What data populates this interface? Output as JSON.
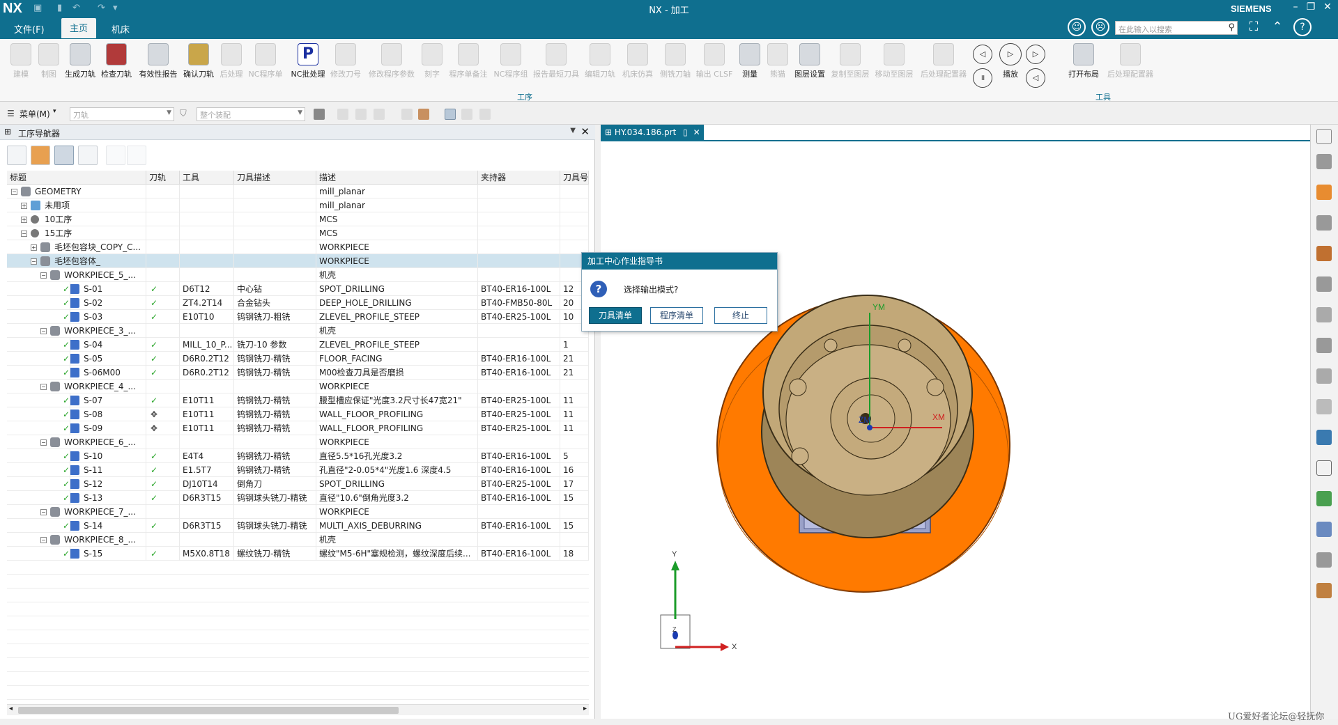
{
  "titlebar": {
    "logo": "NX",
    "title": "NX - 加工",
    "brand": "SIEMENS"
  },
  "menubar": {
    "file": "文件(F)",
    "home": "主页",
    "machine": "机床"
  },
  "search": {
    "placeholder": "在此输入以搜索"
  },
  "ribbon": {
    "buttons": [
      "建模",
      "制图",
      "生成刀轨",
      "检查刀轨",
      "有效性报告",
      "确认刀轨",
      "后处理",
      "NC程序单",
      "NC批处理",
      "修改刀号",
      "修改程序参数",
      "刻字",
      "程序单备注",
      "NC程序组",
      "报告最短刀具",
      "编辑刀轨",
      "机床仿真",
      "侧铣刀轴",
      "输出 CLSF",
      "测量",
      "熊猫",
      "图层设置",
      "复制至图层",
      "移动至图层",
      "后处理配置器"
    ],
    "right_buttons": [
      "播放",
      "打开布局",
      "后处理配置器"
    ],
    "groups": {
      "ops": "工序",
      "tools": "工具"
    }
  },
  "toolbar2": {
    "menu_label": "菜单(M)",
    "filter_path": "刀轨",
    "filter_asm": "整个装配"
  },
  "navigator": {
    "title": "工序导航器",
    "columns": [
      "标题",
      "刀轨",
      "工具",
      "刀具描述",
      "描述",
      "夹持器",
      "刀具号"
    ],
    "rows": [
      {
        "name": "GEOMETRY",
        "path": "",
        "tool": "",
        "tdesc": "",
        "desc": "mill_planar",
        "holder": "",
        "num": ""
      },
      {
        "name": "未用项",
        "path": "",
        "tool": "",
        "tdesc": "",
        "desc": "mill_planar",
        "holder": "",
        "num": ""
      },
      {
        "name": "10工序",
        "path": "",
        "tool": "",
        "tdesc": "",
        "desc": "MCS",
        "holder": "",
        "num": ""
      },
      {
        "name": "15工序",
        "path": "",
        "tool": "",
        "tdesc": "",
        "desc": "MCS",
        "holder": "",
        "num": ""
      },
      {
        "name": "毛坯包容块_COPY_C...",
        "path": "",
        "tool": "",
        "tdesc": "",
        "desc": "WORKPIECE",
        "holder": "",
        "num": ""
      },
      {
        "name": "毛坯包容体_",
        "path": "",
        "tool": "",
        "tdesc": "",
        "desc": "WORKPIECE",
        "holder": "",
        "num": ""
      },
      {
        "name": "WORKPIECE_5_...",
        "path": "",
        "tool": "",
        "tdesc": "",
        "desc": "机壳",
        "holder": "",
        "num": ""
      },
      {
        "name": "S-01",
        "path": "✓",
        "tool": "D6T12",
        "tdesc": "中心钻",
        "desc": "SPOT_DRILLING",
        "holder": "BT40-ER16-100L",
        "num": "12"
      },
      {
        "name": "S-02",
        "path": "✓",
        "tool": "ZT4.2T14",
        "tdesc": "合金钻头",
        "desc": "DEEP_HOLE_DRILLING",
        "holder": "BT40-FMB50-80L",
        "num": "20"
      },
      {
        "name": "S-03",
        "path": "✓",
        "tool": "E10T10",
        "tdesc": "钨钢铣刀-粗铣",
        "desc": "ZLEVEL_PROFILE_STEEP",
        "holder": "BT40-ER25-100L",
        "num": "10"
      },
      {
        "name": "WORKPIECE_3_...",
        "path": "",
        "tool": "",
        "tdesc": "",
        "desc": "机壳",
        "holder": "",
        "num": ""
      },
      {
        "name": "S-04",
        "path": "✓",
        "tool": "MILL_10_P...",
        "tdesc": "铣刀-10 参数",
        "desc": "ZLEVEL_PROFILE_STEEP",
        "holder": "",
        "num": "1"
      },
      {
        "name": "S-05",
        "path": "✓",
        "tool": "D6R0.2T12",
        "tdesc": "钨钢铣刀-精铣",
        "desc": "FLOOR_FACING",
        "holder": "BT40-ER16-100L",
        "num": "21"
      },
      {
        "name": "S-06M00",
        "path": "✓",
        "tool": "D6R0.2T12",
        "tdesc": "钨钢铣刀-精铣",
        "desc": "M00检查刀具是否磨损",
        "holder": "BT40-ER16-100L",
        "num": "21"
      },
      {
        "name": "WORKPIECE_4_...",
        "path": "",
        "tool": "",
        "tdesc": "",
        "desc": "WORKPIECE",
        "holder": "",
        "num": ""
      },
      {
        "name": "S-07",
        "path": "✓",
        "tool": "E10T11",
        "tdesc": "钨钢铣刀-精铣",
        "desc": "腰型槽应保证\"光度3.2尺寸长47宽21\"",
        "holder": "BT40-ER25-100L",
        "num": "11"
      },
      {
        "name": "S-08",
        "path": "✥",
        "tool": "E10T11",
        "tdesc": "钨钢铣刀-精铣",
        "desc": "WALL_FLOOR_PROFILING",
        "holder": "BT40-ER25-100L",
        "num": "11"
      },
      {
        "name": "S-09",
        "path": "✥",
        "tool": "E10T11",
        "tdesc": "钨钢铣刀-精铣",
        "desc": "WALL_FLOOR_PROFILING",
        "holder": "BT40-ER25-100L",
        "num": "11"
      },
      {
        "name": "WORKPIECE_6_...",
        "path": "",
        "tool": "",
        "tdesc": "",
        "desc": "WORKPIECE",
        "holder": "",
        "num": ""
      },
      {
        "name": "S-10",
        "path": "✓",
        "tool": "E4T4",
        "tdesc": "钨钢铣刀-精铣",
        "desc": "直径5.5*16孔光度3.2",
        "holder": "BT40-ER16-100L",
        "num": "5"
      },
      {
        "name": "S-11",
        "path": "✓",
        "tool": "E1.5T7",
        "tdesc": "钨钢铣刀-精铣",
        "desc": "孔直径\"2-0.05*4\"光度1.6 深度4.5",
        "holder": "BT40-ER16-100L",
        "num": "16"
      },
      {
        "name": "S-12",
        "path": "✓",
        "tool": "DJ10T14",
        "tdesc": "倒角刀",
        "desc": "SPOT_DRILLING",
        "holder": "BT40-ER25-100L",
        "num": "17"
      },
      {
        "name": "S-13",
        "path": "✓",
        "tool": "D6R3T15",
        "tdesc": "钨钢球头铣刀-精铣",
        "desc": "直径\"10.6\"倒角光度3.2",
        "holder": "BT40-ER16-100L",
        "num": "15"
      },
      {
        "name": "WORKPIECE_7_...",
        "path": "",
        "tool": "",
        "tdesc": "",
        "desc": "WORKPIECE",
        "holder": "",
        "num": ""
      },
      {
        "name": "S-14",
        "path": "✓",
        "tool": "D6R3T15",
        "tdesc": "钨钢球头铣刀-精铣",
        "desc": "MULTI_AXIS_DEBURRING",
        "holder": "BT40-ER16-100L",
        "num": "15"
      },
      {
        "name": "WORKPIECE_8_...",
        "path": "",
        "tool": "",
        "tdesc": "",
        "desc": "机壳",
        "holder": "",
        "num": ""
      },
      {
        "name": "S-15",
        "path": "✓",
        "tool": "M5X0.8T18",
        "tdesc": "螺纹铣刀-精铣",
        "desc": "螺纹\"M5-6H\"塞规检测，螺纹深度后续...",
        "holder": "BT40-ER16-100L",
        "num": "18"
      }
    ]
  },
  "graphics": {
    "tab": "HY.034.186.prt",
    "axis": {
      "ym": "YM",
      "xm": "XM",
      "zm": "ZM",
      "y": "Y",
      "x": "X",
      "z": "Z"
    }
  },
  "dialog": {
    "title": "加工中心作业指导书",
    "message": "选择输出模式?",
    "btn_tools": "刀具清单",
    "btn_program": "程序清单",
    "btn_stop": "终止"
  },
  "watermark": "UG爱好者论坛@轻抚你",
  "colors": {
    "brand": "#0f6f8f",
    "base_orange": "#ff7a00",
    "part_tan": "#c2a878",
    "check": "#2aa52a"
  }
}
